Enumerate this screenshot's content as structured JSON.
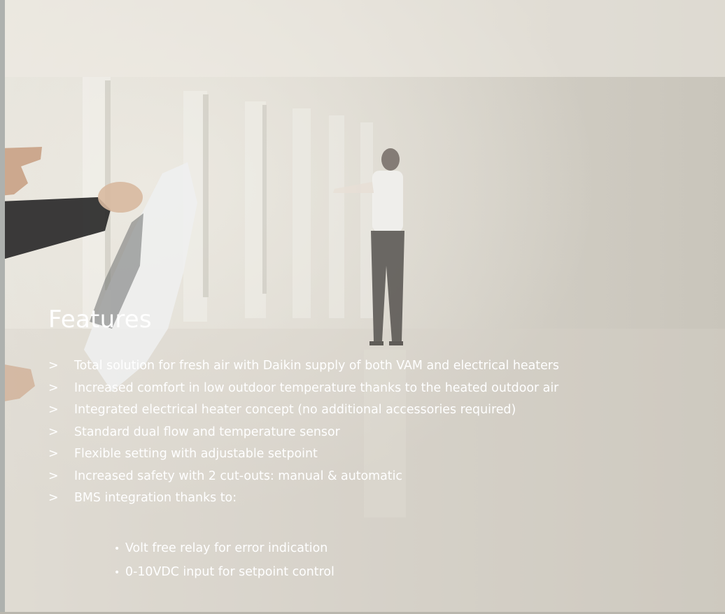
{
  "section": {
    "title": "Features",
    "bullet_marker": ">",
    "items": [
      "Total solution for fresh air with Daikin supply of both VAM and electrical heaters",
      "Increased comfort in low outdoor temperature thanks to the heated outdoor air",
      "Integrated electrical heater concept (no additional accessories required)",
      "Standard dual flow and temperature sensor",
      "Flexible setting with adjustable setpoint",
      "Increased safety with 2 cut-outs: manual & automatic",
      "BMS integration thanks to:"
    ],
    "sub_marker": "•",
    "sub_items": [
      "Volt free relay for error indication",
      "0-10VDC input for setpoint control"
    ]
  },
  "colors": {
    "text": "#ffffff",
    "background": "#d8d4cb"
  }
}
